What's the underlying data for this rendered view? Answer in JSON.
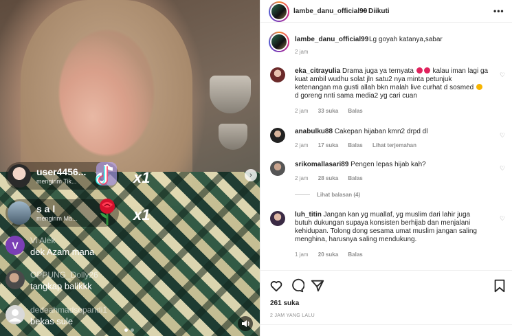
{
  "stream": {
    "gifts": [
      {
        "name": "user4456...",
        "sub": "mengirim Tik...",
        "count": "x1",
        "icon": "tiktok-note-icon"
      },
      {
        "name": "s a l",
        "sub": "mengirim Ma...",
        "count": "x1",
        "icon": "rose-icon"
      }
    ],
    "comments": [
      {
        "user": "Vi Alek",
        "avatar_letter": "V",
        "text": "dek Azam mana"
      },
      {
        "user": "OPPUNG_Dolly26",
        "text": "tangkap balikkk"
      },
      {
        "user": "dedeahmadsopandi1",
        "text": "bekas sule"
      }
    ]
  },
  "post": {
    "author": "lambe_danu_official99",
    "separator": "•",
    "follow_status": "Diikuti",
    "caption": "Lg goyah katanya,sabar",
    "caption_time": "2 jam",
    "comments": [
      {
        "user": "eka_citrayulia",
        "text_a": "Drama juga ya ternyata",
        "text_b": "kalau iman lagi ga kuat ambil wudhu solat jln satu2 nya minta petunjuk ketenangan ma gusti allah bkn malah live curhat d sosmed",
        "text_c": "d goreng nnti sama media2 yg cari cuan",
        "time": "2 jam",
        "likes": "33 suka",
        "reply": "Balas"
      },
      {
        "user": "anabulku88",
        "text": "Cakepan hijaban kmn2 drpd dl",
        "time": "2 jam",
        "likes": "17 suka",
        "reply": "Balas",
        "translate": "Lihat terjemahan"
      },
      {
        "user": "srikomallasari89",
        "text": "Pengen lepas hijab kah?",
        "time": "2 jam",
        "likes": "28 suka",
        "reply": "Balas"
      },
      {
        "user": "luh_titin",
        "text": "Jangan kan yg muallaf, yg muslim dari lahir juga butuh dukungan supaya konsisten berhijab dan menjalani kehidupan. Tolong dong sesama umat muslim jangan saling menghina, harusnya saling mendukung.",
        "time": "1 jam",
        "likes": "20 suka",
        "reply": "Balas"
      }
    ],
    "view_replies": "Lihat balasan (4)",
    "likes_total": "261 suka",
    "posted_ago": "2 JAM YANG LALU"
  },
  "colors": {
    "accent_text": "#262626",
    "muted": "#8e8e8e",
    "divider": "#efefef"
  }
}
